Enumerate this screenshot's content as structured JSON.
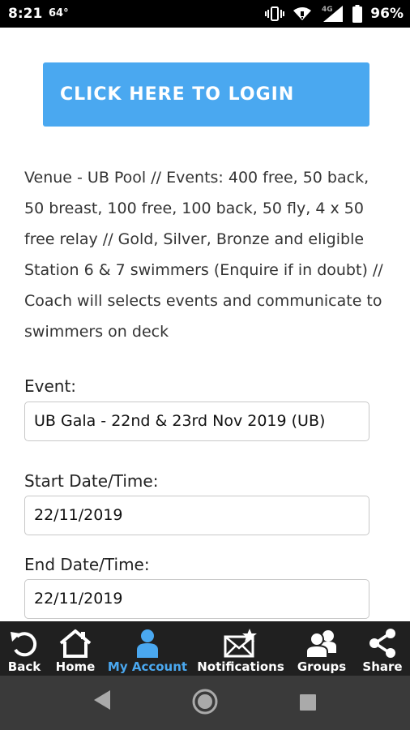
{
  "status_bar": {
    "time": "8:21",
    "temperature": "64°",
    "battery": "96%"
  },
  "login_button": {
    "label": "CLICK HERE TO LOGIN"
  },
  "description": "Venue - UB Pool // Events: 400 free, 50 back, 50 breast, 100 free, 100 back, 50 fly, 4 x 50 free relay // Gold, Silver, Bronze and eligible Station 6 & 7 swimmers (Enquire if in doubt) // Coach will selects events and communicate to swimmers on deck",
  "fields": {
    "event_label": "Event:",
    "event_value": "UB Gala - 22nd & 23rd Nov 2019 (UB)",
    "start_label": "Start Date/Time:",
    "start_value": "22/11/2019",
    "end_label": "End Date/Time:",
    "end_value": "22/11/2019"
  },
  "bottom_nav": {
    "items": [
      {
        "label": "Back",
        "icon": "back-arrow-icon"
      },
      {
        "label": "Home",
        "icon": "home-icon"
      },
      {
        "label": "My Account",
        "icon": "person-icon"
      },
      {
        "label": "Notifications",
        "icon": "envelope-star-icon"
      },
      {
        "label": "Groups",
        "icon": "group-icon"
      },
      {
        "label": "Share",
        "icon": "share-icon"
      }
    ],
    "active_color": "#4aa8f0"
  },
  "colors": {
    "accent": "#4aa8f0",
    "nav_background": "#202020",
    "system_nav_background": "#3a3a3a"
  }
}
